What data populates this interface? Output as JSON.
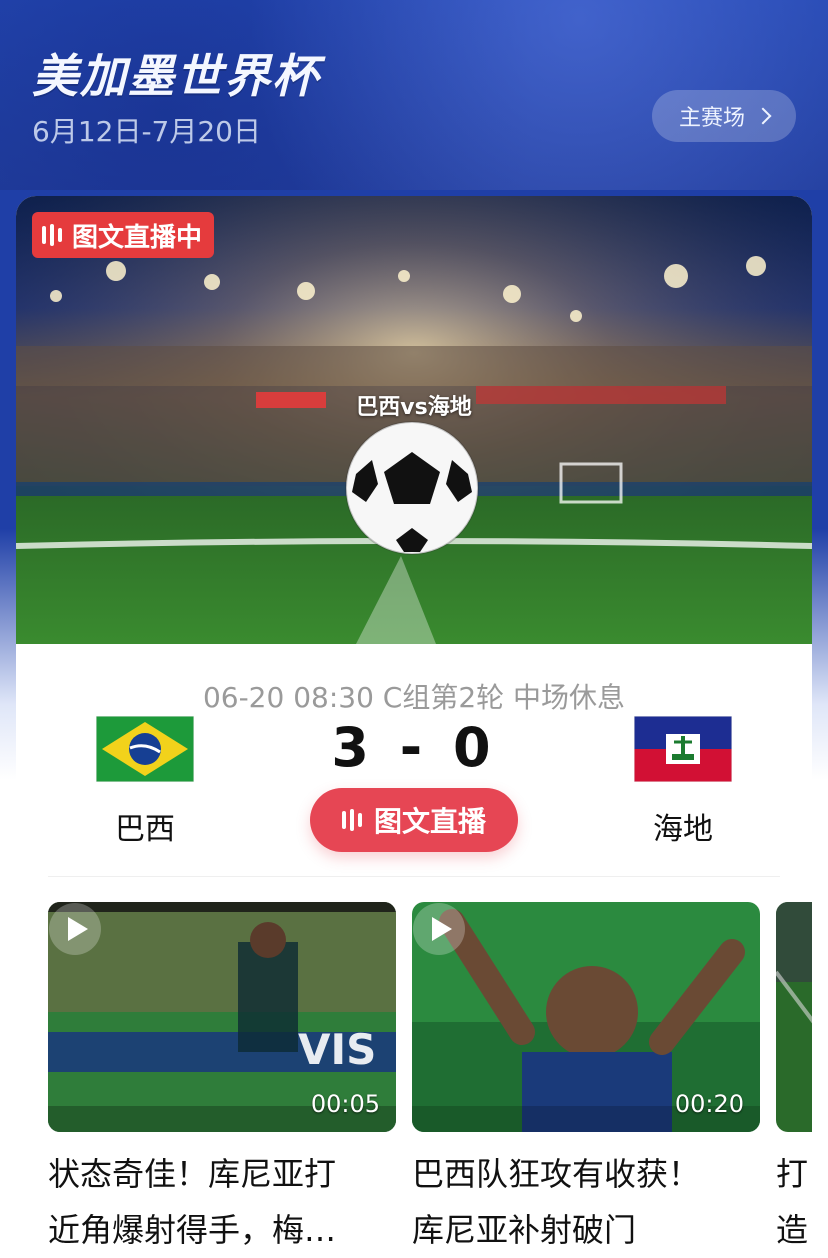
{
  "header": {
    "title": "美加墨世界杯",
    "dates": "6月12日-7月20日",
    "main_venue_label": "主赛场"
  },
  "hero": {
    "live_badge": "图文直播中",
    "match_title": "巴西vs海地"
  },
  "match": {
    "meta": "06-20 08:30  C组第2轮  中场休息",
    "home_team": "巴西",
    "away_team": "海地",
    "score": "3 - 0",
    "live_button": "图文直播"
  },
  "videos": [
    {
      "duration": "00:05",
      "title_line1": "状态奇佳！库尼亚打",
      "title_line2": "近角爆射得手，梅…"
    },
    {
      "duration": "00:20",
      "title_line1": "巴西队狂攻有收获！",
      "title_line2": "库尼亚补射破门"
    },
    {
      "duration": "",
      "title_line1": "打",
      "title_line2": "造"
    }
  ],
  "colors": {
    "header_blue": "#2447b1",
    "live_red": "#e53b3d",
    "button_red": "#e64654"
  }
}
